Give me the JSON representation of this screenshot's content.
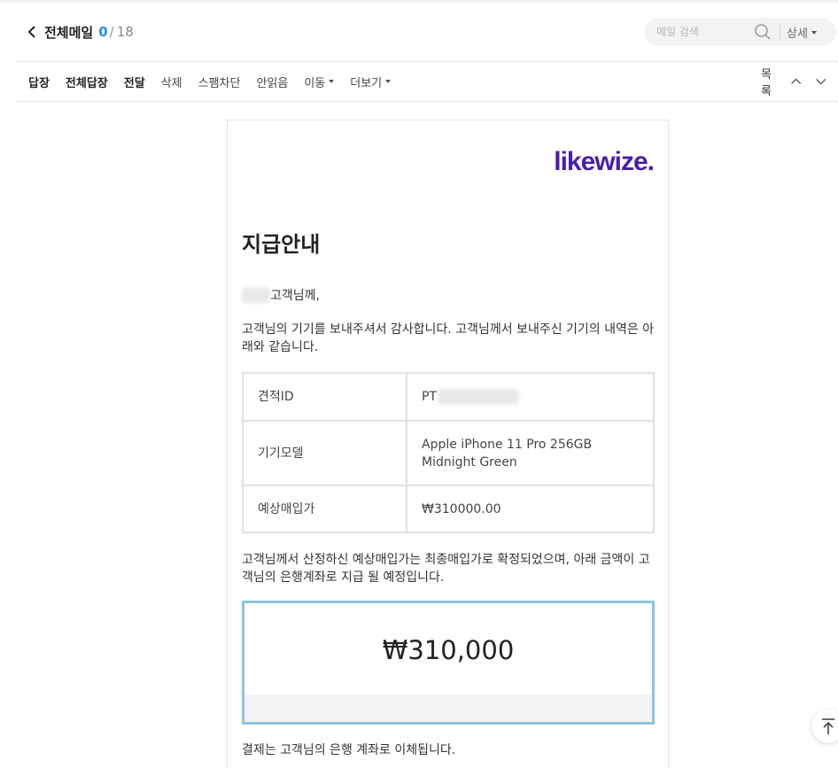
{
  "header": {
    "folder_title": "전체메일",
    "unread_count": "0",
    "separator": "/",
    "total_count": "18",
    "search_placeholder": "메일 검색",
    "detail_label": "상세"
  },
  "toolbar": {
    "reply": "답장",
    "reply_all": "전체답장",
    "forward": "전달",
    "delete": "삭제",
    "spam_block": "스팸차단",
    "unread": "안읽음",
    "move": "이동",
    "more": "더보기",
    "list": "목록"
  },
  "mail": {
    "logo": "likewize",
    "logo_dot": ".",
    "heading": "지급안내",
    "greeting_suffix": "고객님께,",
    "paragraph1": "고객님의 기기를 보내주셔서 감사합니다. 고객님께서 보내주신 기기의 내역은 아래와 같습니다.",
    "table": {
      "quote_id_label": "견적ID",
      "quote_id_value": "PT",
      "model_label": "기기모델",
      "model_value": "Apple iPhone 11 Pro 256GB Midnight Green",
      "price_label": "예상매입가",
      "price_value": "₩310000.00"
    },
    "paragraph2": "고객님께서 산정하신 예상매입가는 최종매입가로 확정되었으며, 아래 금액이 고객님의 은행계좌로 지급 될 예정입니다.",
    "amount": "₩310,000",
    "paragraph3": "결제는 고객님의 은행 계좌로 이체됩니다."
  },
  "colors": {
    "accent_count": "#2a8ee6",
    "logo": "#4b1ea8",
    "amount_border": "#89c6e0"
  },
  "icons": {
    "back": "chevron-left-icon",
    "search": "search-icon",
    "up": "chevron-up-icon",
    "down": "chevron-down-icon",
    "scroll_top": "arrow-up-to-top-icon"
  }
}
